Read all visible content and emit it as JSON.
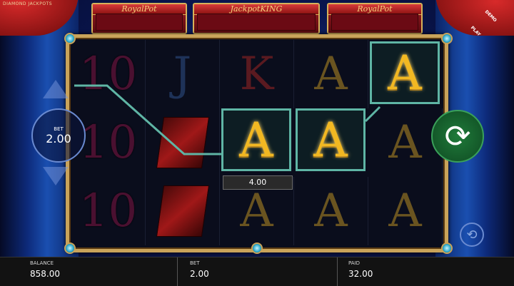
{
  "brand": "DIAMOND JACKPOTS",
  "demo_label": "DEMO PLAY",
  "jackpots": [
    {
      "label": "RoyalPot"
    },
    {
      "label": "JackpotKING"
    },
    {
      "label": "RoyalPot"
    }
  ],
  "reels": [
    [
      "10",
      "10",
      "10"
    ],
    [
      "J",
      "",
      ""
    ],
    [
      "K",
      "A",
      "A"
    ],
    [
      "A",
      "A",
      "A"
    ],
    [
      "A",
      "A",
      "A"
    ]
  ],
  "win_amount": "4.00",
  "bet_control": {
    "label": "BET",
    "value": "2.00"
  },
  "spin_icon": "spin-arrow-icon",
  "autoplay_icon": "autoplay-icon",
  "bottom": {
    "balance_label": "BALANCE",
    "balance_value": "858.00",
    "bet_label": "BET",
    "bet_value": "2.00",
    "paid_label": "PAID",
    "paid_value": "32.00"
  }
}
